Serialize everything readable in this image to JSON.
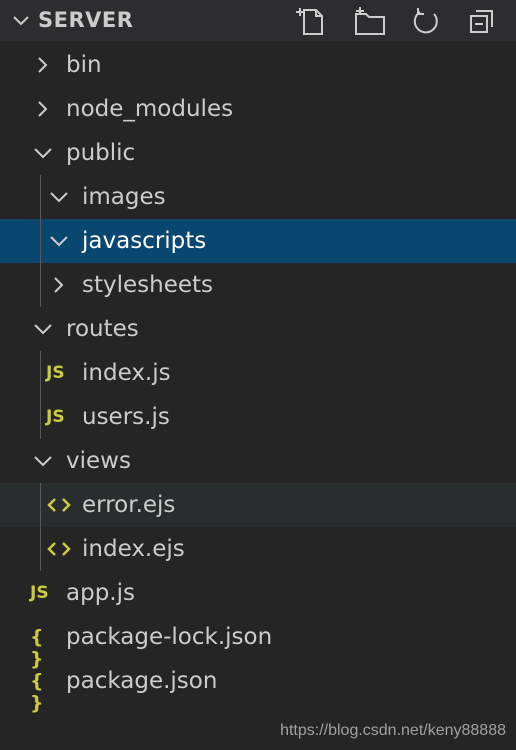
{
  "header": {
    "title": "SERVER"
  },
  "tree": [
    {
      "label": "bin",
      "kind": "folder",
      "expanded": false,
      "depth": 0
    },
    {
      "label": "node_modules",
      "kind": "folder",
      "expanded": false,
      "depth": 0
    },
    {
      "label": "public",
      "kind": "folder",
      "expanded": true,
      "depth": 0
    },
    {
      "label": "images",
      "kind": "folder",
      "expanded": true,
      "depth": 1
    },
    {
      "label": "javascripts",
      "kind": "folder",
      "expanded": true,
      "depth": 1,
      "selected": true
    },
    {
      "label": "stylesheets",
      "kind": "folder",
      "expanded": false,
      "depth": 1
    },
    {
      "label": "routes",
      "kind": "folder",
      "expanded": true,
      "depth": 0
    },
    {
      "label": "index.js",
      "kind": "js",
      "depth": 1
    },
    {
      "label": "users.js",
      "kind": "js",
      "depth": 1
    },
    {
      "label": "views",
      "kind": "folder",
      "expanded": true,
      "depth": 0
    },
    {
      "label": "error.ejs",
      "kind": "ejs",
      "depth": 1,
      "hover": true
    },
    {
      "label": "index.ejs",
      "kind": "ejs",
      "depth": 1
    },
    {
      "label": "app.js",
      "kind": "js",
      "depth": 0
    },
    {
      "label": "package-lock.json",
      "kind": "json",
      "depth": 0
    },
    {
      "label": "package.json",
      "kind": "json",
      "depth": 0
    }
  ],
  "icons": {
    "js": "JS",
    "json": "{ }"
  },
  "colors": {
    "background": "#252526",
    "header": "#2d2d2f",
    "selected": "#094771",
    "js_icon": "#cbcb41",
    "ejs_icon": "#cbcb41"
  },
  "watermark": "https://blog.csdn.net/keny88888"
}
